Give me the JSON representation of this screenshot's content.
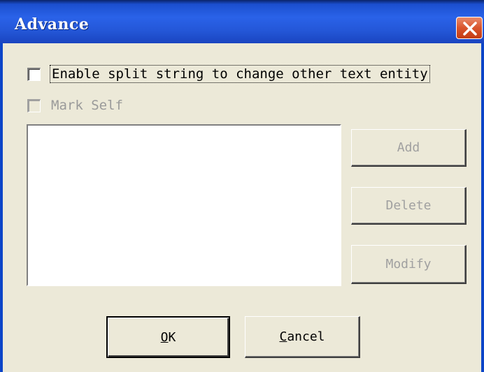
{
  "window": {
    "title": "Advance",
    "close_icon": "close-icon",
    "titlebar_color": "#2457d8",
    "close_color": "#d9542c"
  },
  "options": {
    "enable_split": {
      "label": "Enable split string to change other text entity",
      "checked": false,
      "enabled": true
    },
    "mark_self": {
      "label": "Mark Self",
      "checked": false,
      "enabled": false
    }
  },
  "list": {
    "items": []
  },
  "side_buttons": {
    "add": "Add",
    "delete": "Delete",
    "modify": "Modify"
  },
  "footer": {
    "ok_mnemonic": "O",
    "ok_rest": "K",
    "cancel_mnemonic": "C",
    "cancel_rest": "ancel"
  }
}
